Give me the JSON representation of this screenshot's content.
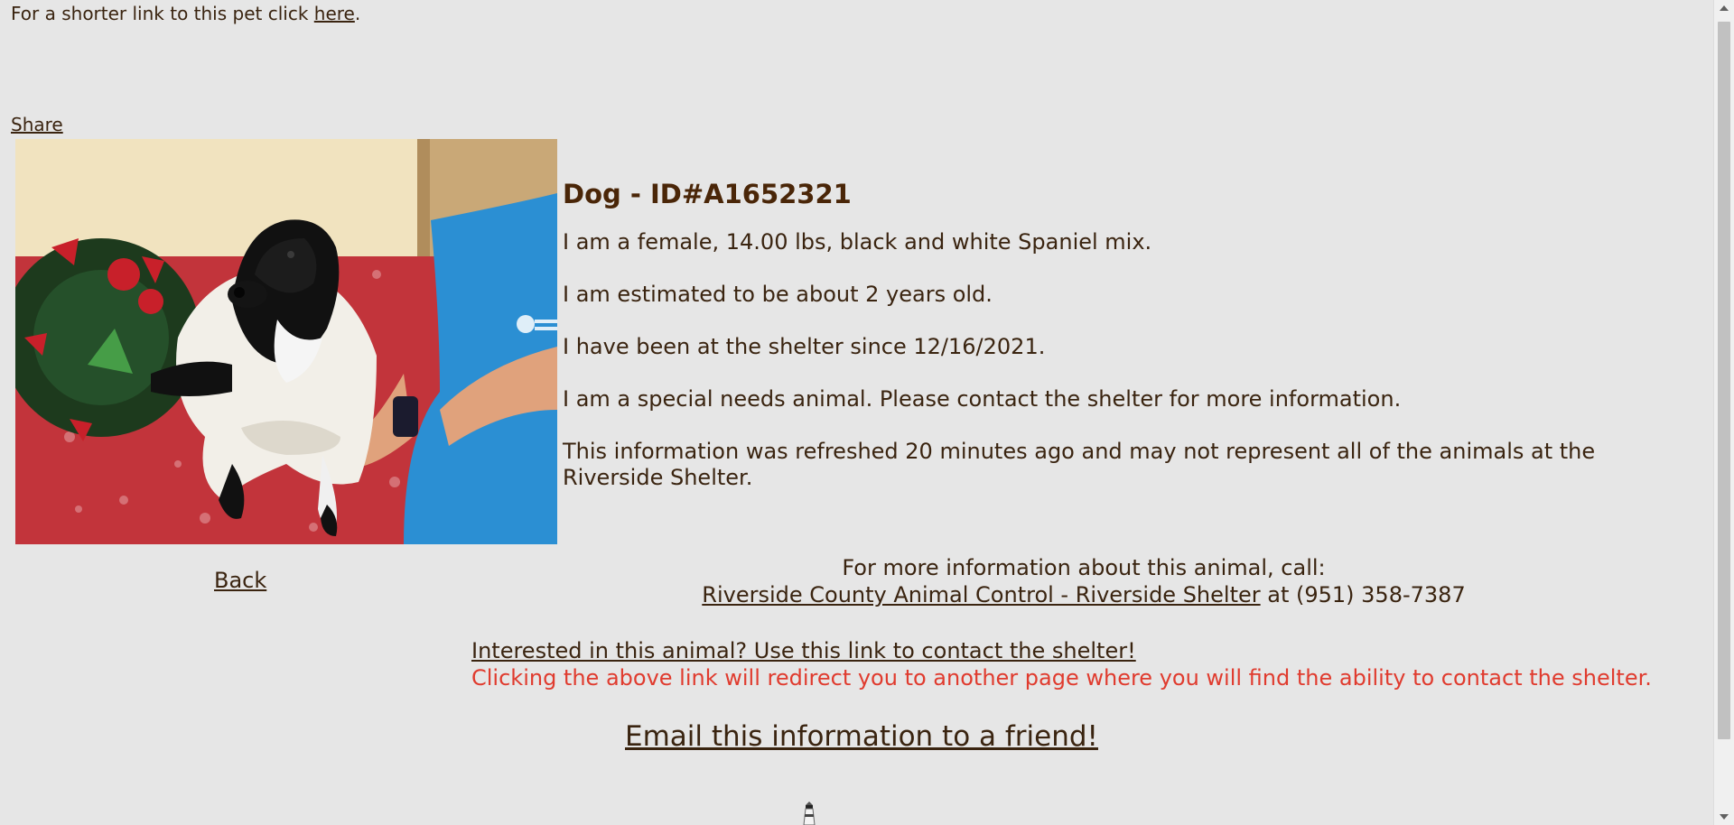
{
  "top": {
    "shorter_prefix": "For a shorter link to this pet click ",
    "shorter_link": "here",
    "shorter_suffix": "."
  },
  "share_label": "Share",
  "photo": {
    "alt": "Black and white spaniel mix dog held in a towel"
  },
  "back_label": "Back",
  "animal": {
    "title": "Dog - ID#A1652321",
    "line1": "I am a female, 14.00 lbs, black and white Spaniel mix.",
    "line2": "I am estimated to be about 2 years old.",
    "line3": "I have been at the shelter since 12/16/2021.",
    "line4": "I am a special needs animal. Please contact the shelter for more information.",
    "line5": "This information was refreshed 20 minutes ago and may not represent all of the animals at the Riverside Shelter."
  },
  "contact": {
    "call_text": "For more information about this animal, call:",
    "shelter_link": "Riverside County Animal Control - Riverside Shelter",
    "phone_text": " at (951) 358-7387"
  },
  "interest": {
    "link": "Interested in this animal? Use this link to contact the shelter!",
    "warning": "Clicking the above link will redirect you to another page where you will find the ability to contact the shelter."
  },
  "email_label": "Email this information to a friend!",
  "colors": {
    "background": "#e6e6e6",
    "text": "#3a2410",
    "title": "#4a2608",
    "warning": "#e03b2e"
  }
}
